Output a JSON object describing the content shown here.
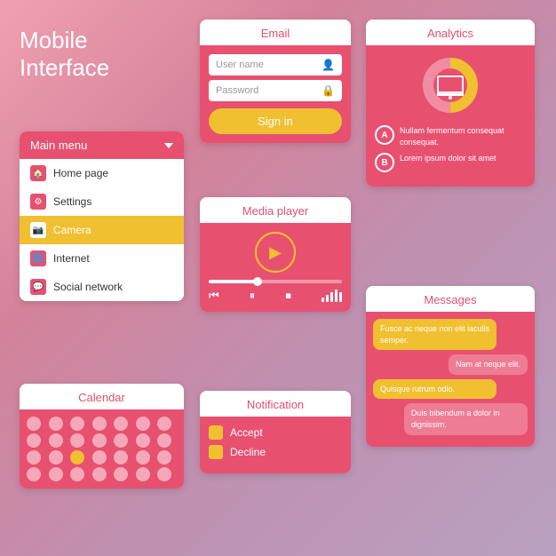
{
  "title": {
    "line1": "Mobile",
    "line2": "Interface"
  },
  "menu": {
    "header": "Main menu",
    "items": [
      {
        "label": "Home page",
        "icon": "🏠",
        "active": false
      },
      {
        "label": "Settings",
        "icon": "⚙",
        "active": false
      },
      {
        "label": "Camera",
        "icon": "📷",
        "active": true
      },
      {
        "label": "Internet",
        "icon": "🌐",
        "active": false
      },
      {
        "label": "Social network",
        "icon": "💬",
        "active": false
      }
    ]
  },
  "email": {
    "title": "Email",
    "username_placeholder": "User name",
    "password_placeholder": "Password",
    "signin_label": "Sign in"
  },
  "analytics": {
    "title": "Analytics",
    "item_a_text": "Nullam fermentum consequat consequat.",
    "item_b_text": "Lorem ipsum dolor sit amet"
  },
  "media": {
    "title": "Media player"
  },
  "notification": {
    "title": "Notification",
    "accept": "Accept",
    "decline": "Decline"
  },
  "calendar": {
    "title": "Calendar"
  },
  "messages": {
    "title": "Messages",
    "bubbles": [
      {
        "text": "Fusce ac neque non elit iaculis semper.",
        "side": "left"
      },
      {
        "text": "Nam at neque elit.",
        "side": "right"
      },
      {
        "text": "Quisque rutrum odio.",
        "side": "left"
      },
      {
        "text": "Duis bibendum a dolor in dignissim.",
        "side": "right"
      }
    ]
  },
  "colors": {
    "accent": "#e85070",
    "yellow": "#f0c030",
    "white": "#ffffff"
  }
}
